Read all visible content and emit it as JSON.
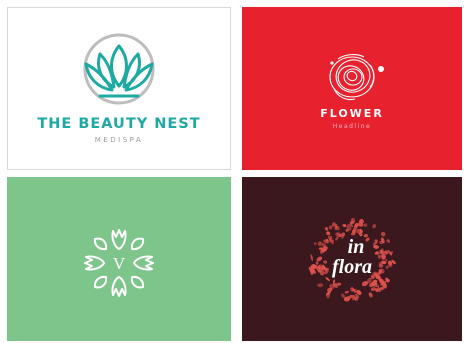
{
  "colors": {
    "tile1_bg": "#ffffff",
    "tile1_teal": "#1ea9a3",
    "tile1_gray": "#bdbdbd",
    "tile2_bg": "#e8212f",
    "tile3_bg": "#7ec58c",
    "tile4_bg": "#3b171e",
    "tile4_accent": "#e0534d"
  },
  "tiles": [
    {
      "title": "THE BEAUTY NEST",
      "subtitle": "MEDISPA",
      "icon": "lotus-icon"
    },
    {
      "title": "FLOWER",
      "subtitle": "Headline",
      "icon": "rose-icon"
    },
    {
      "monogram": "V",
      "icon": "floral-wreath-icon"
    },
    {
      "script_line1": "in",
      "script_line2": "flora",
      "icon": "floral-wreath-icon"
    }
  ]
}
